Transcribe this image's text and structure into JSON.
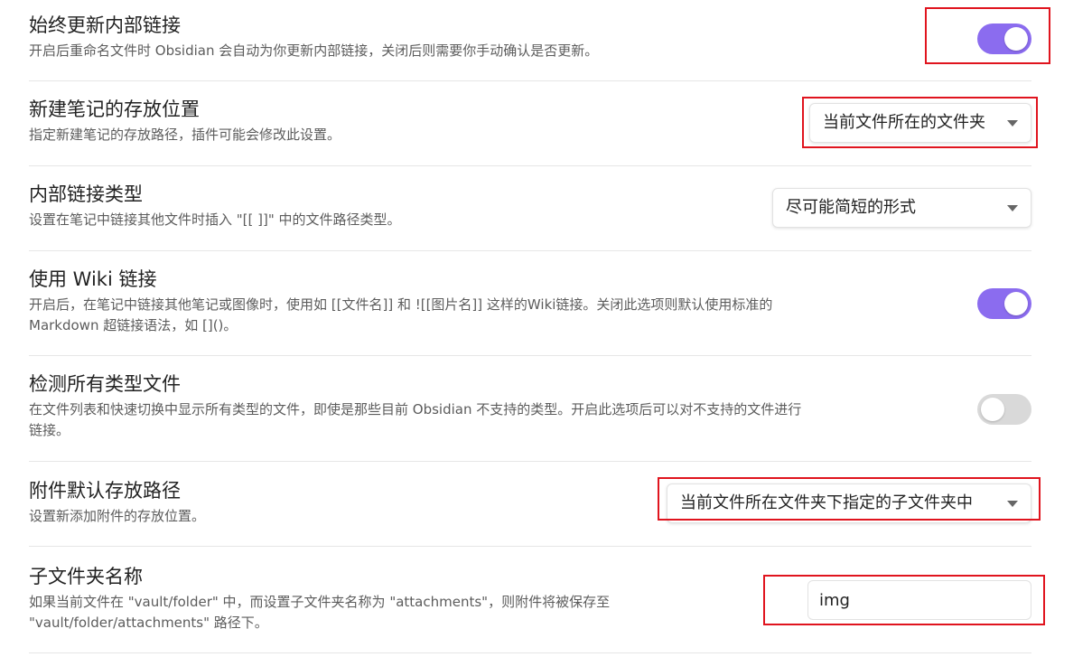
{
  "settings": [
    {
      "title": "始终更新内部链接",
      "desc": "开启后重命名文件时 Obsidian 会自动为你更新内部链接，关闭后则需要你手动确认是否更新。",
      "control": "toggle",
      "state": "on"
    },
    {
      "title": "新建笔记的存放位置",
      "desc": "指定新建笔记的存放路径，插件可能会修改此设置。",
      "control": "dropdown",
      "value": "当前文件所在的文件夹"
    },
    {
      "title": "内部链接类型",
      "desc": "设置在笔记中链接其他文件时插入 \"[[ ]]\" 中的文件路径类型。",
      "control": "dropdown",
      "value": "尽可能简短的形式"
    },
    {
      "title": "使用 Wiki 链接",
      "desc_line1": "开启后，在笔记中链接其他笔记或图像时，使用如 [[文件名]] 和 ![[图片名]] 这样的Wiki链接。关闭此选项则默认使用标准的",
      "desc_line2": "Markdown 超链接语法，如 []()。",
      "control": "toggle",
      "state": "on"
    },
    {
      "title": "检测所有类型文件",
      "desc_line1": "在文件列表和快速切换中显示所有类型的文件，即使是那些目前 Obsidian 不支持的类型。开启此选项后可以对不支持的文件进行",
      "desc_line2": "链接。",
      "control": "toggle",
      "state": "off"
    },
    {
      "title": "附件默认存放路径",
      "desc": "设置新添加附件的存放位置。",
      "control": "dropdown",
      "value": "当前文件所在文件夹下指定的子文件夹中"
    },
    {
      "title": "子文件夹名称",
      "desc_line1": "如果当前文件在 \"vault/folder\" 中，而设置子文件夹名称为 \"attachments\"，则附件将被保存至",
      "desc_line2": "\"vault/folder/attachments\" 路径下。",
      "control": "text",
      "value": "img"
    }
  ],
  "colors": {
    "accent": "#8b6cef",
    "toggle_off": "#d9d9d9",
    "highlight_box": "#e0141e"
  }
}
